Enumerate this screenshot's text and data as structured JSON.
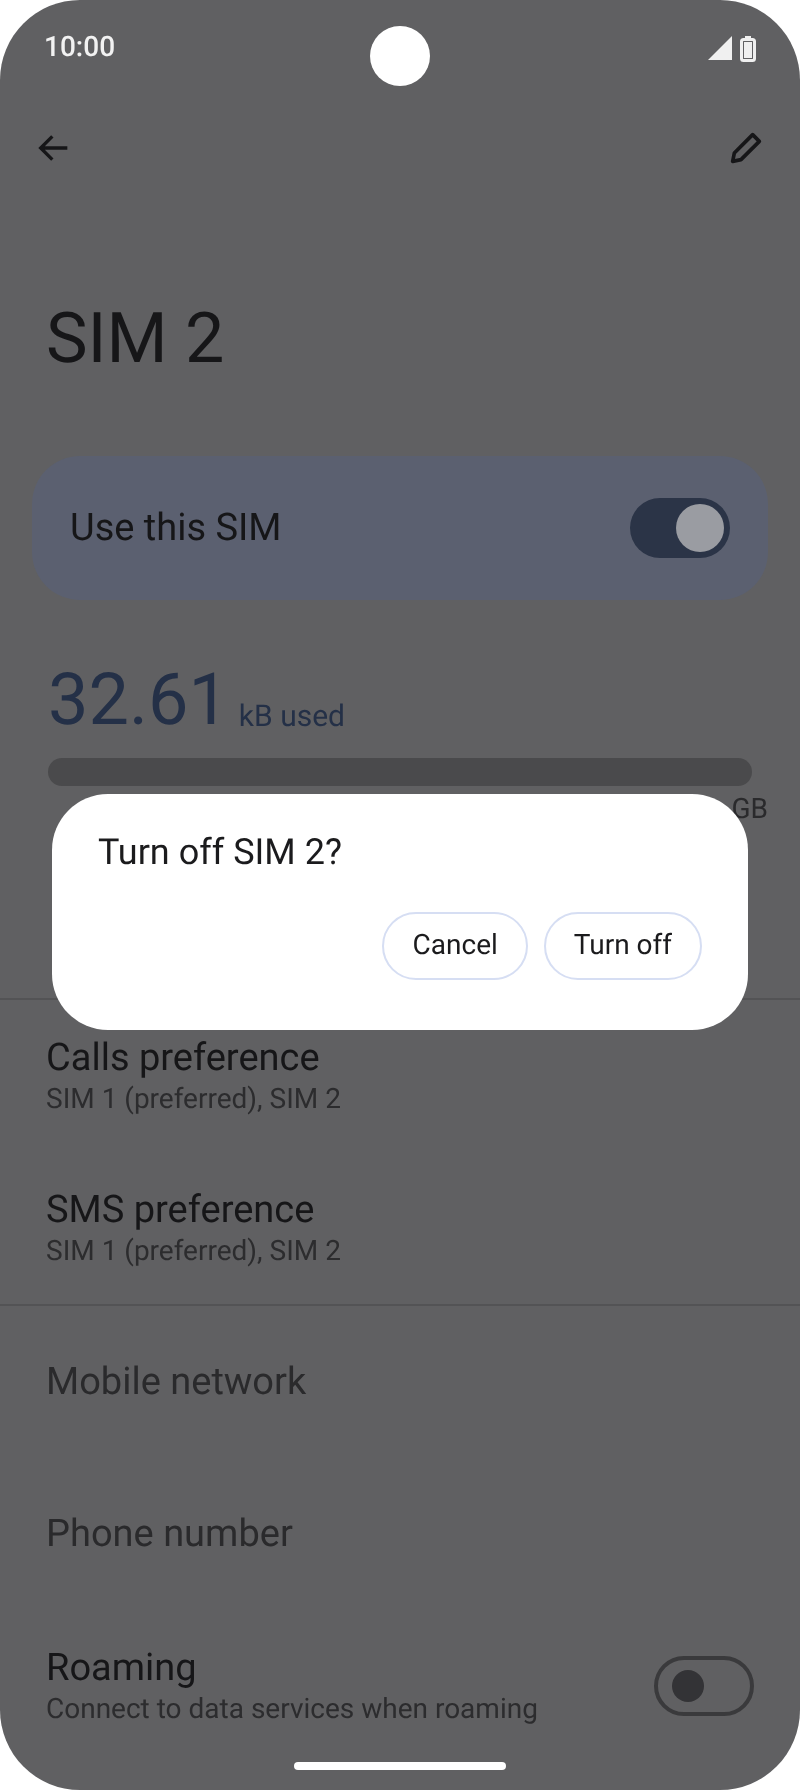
{
  "status_bar": {
    "time": "10:00"
  },
  "title": "SIM 2",
  "use_sim": {
    "label": "Use this SIM",
    "on": true
  },
  "usage": {
    "amount": "32.61",
    "unit": "kB used",
    "range_end": "GB"
  },
  "sections": [
    [
      {
        "kind": "two_line",
        "title": "Calls preference",
        "subtitle": "SIM 1 (preferred), SIM 2"
      },
      {
        "kind": "two_line",
        "title": "SMS preference",
        "subtitle": "SIM 1 (preferred), SIM 2"
      }
    ],
    [
      {
        "kind": "one_line",
        "title": "Mobile network"
      },
      {
        "kind": "one_line",
        "title": "Phone number"
      },
      {
        "kind": "switch",
        "title": "Roaming",
        "subtitle": "Connect to data services when roaming",
        "on": false
      }
    ]
  ],
  "dialog": {
    "title": "Turn off SIM 2?",
    "buttons": [
      "Cancel",
      "Turn off"
    ]
  }
}
